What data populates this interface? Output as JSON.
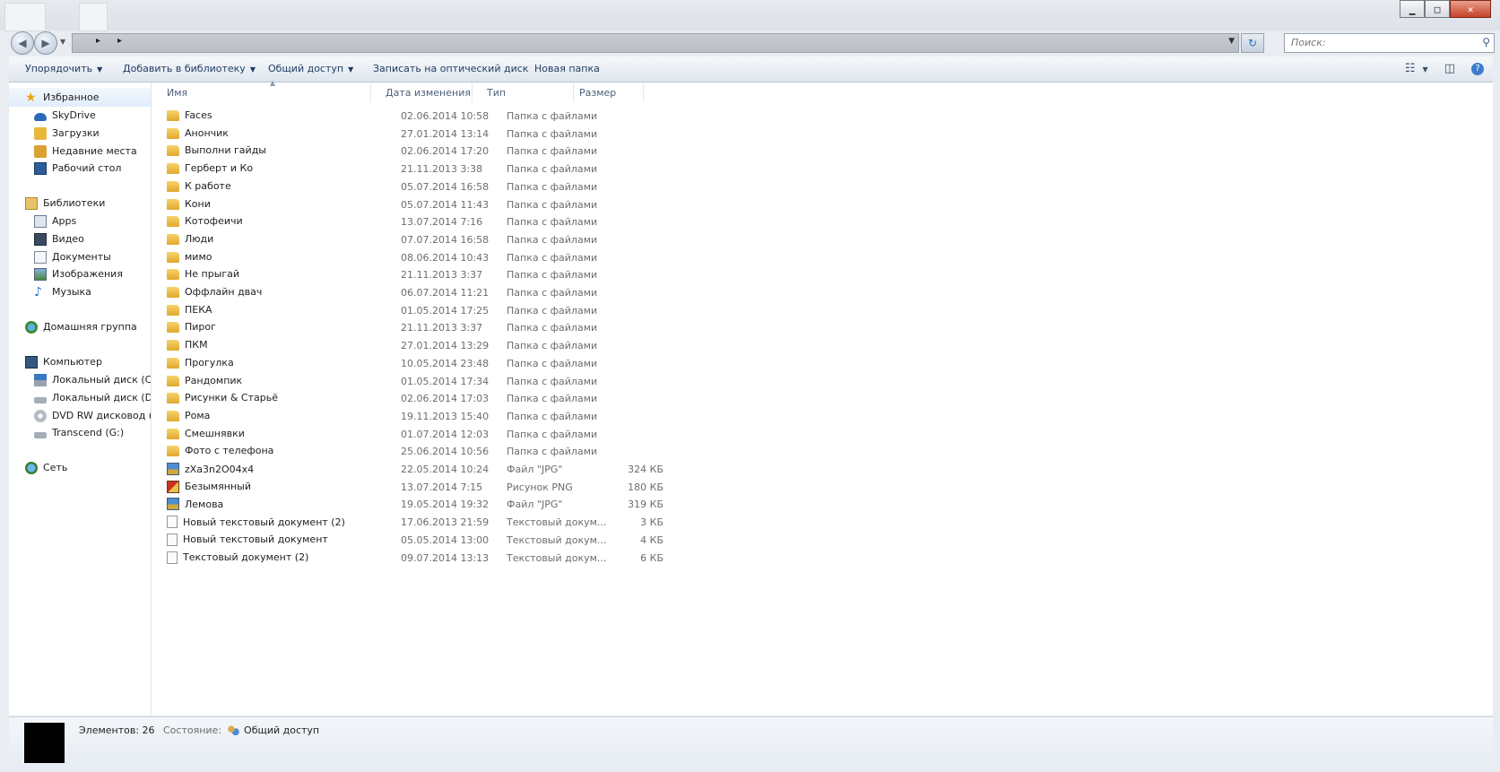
{
  "window_controls": {
    "minimize": "▁",
    "maximize": "□",
    "close": "✕"
  },
  "address_bar": {
    "crumb_separators": [
      "▸",
      "▸"
    ]
  },
  "search": {
    "placeholder": "Поиск:"
  },
  "toolbar": {
    "organize": "Упорядочить",
    "add_to_library": "Добавить в библиотеку",
    "share": "Общий доступ",
    "burn": "Записать на оптический диск",
    "new_folder": "Новая папка"
  },
  "navpane": {
    "favorites": "Избранное",
    "favorites_items": [
      "SkyDrive",
      "Загрузки",
      "Недавние места",
      "Рабочий стол"
    ],
    "libraries": "Библиотеки",
    "libraries_items": [
      "Apps",
      "Видео",
      "Документы",
      "Изображения",
      "Музыка"
    ],
    "homegroup": "Домашняя группа",
    "computer": "Компьютер",
    "computer_items": [
      "Локальный диск (C",
      "Локальный диск (D",
      "DVD RW дисковод (",
      "Transcend (G:)"
    ],
    "network": "Сеть"
  },
  "columns": {
    "name": "Имя",
    "date": "Дата изменения",
    "type": "Тип",
    "size": "Размер"
  },
  "files": [
    {
      "name": "Faces",
      "date": "02.06.2014 10:58",
      "type": "Папка с файлами",
      "size": "",
      "icon": "folder"
    },
    {
      "name": "Анончик",
      "date": "27.01.2014 13:14",
      "type": "Папка с файлами",
      "size": "",
      "icon": "folder"
    },
    {
      "name": "Выполни гайды",
      "date": "02.06.2014 17:20",
      "type": "Папка с файлами",
      "size": "",
      "icon": "folder"
    },
    {
      "name": "Герберт и Ко",
      "date": "21.11.2013 3:38",
      "type": "Папка с файлами",
      "size": "",
      "icon": "folder"
    },
    {
      "name": "К работе",
      "date": "05.07.2014 16:58",
      "type": "Папка с файлами",
      "size": "",
      "icon": "folder"
    },
    {
      "name": "Кони",
      "date": "05.07.2014 11:43",
      "type": "Папка с файлами",
      "size": "",
      "icon": "folder"
    },
    {
      "name": "Котофеичи",
      "date": "13.07.2014 7:16",
      "type": "Папка с файлами",
      "size": "",
      "icon": "folder"
    },
    {
      "name": "Люди",
      "date": "07.07.2014 16:58",
      "type": "Папка с файлами",
      "size": "",
      "icon": "folder"
    },
    {
      "name": "мимо",
      "date": "08.06.2014 10:43",
      "type": "Папка с файлами",
      "size": "",
      "icon": "folder"
    },
    {
      "name": "Не прыгай",
      "date": "21.11.2013 3:37",
      "type": "Папка с файлами",
      "size": "",
      "icon": "folder"
    },
    {
      "name": "Оффлайн двач",
      "date": "06.07.2014 11:21",
      "type": "Папка с файлами",
      "size": "",
      "icon": "folder"
    },
    {
      "name": "ПЕКА",
      "date": "01.05.2014 17:25",
      "type": "Папка с файлами",
      "size": "",
      "icon": "folder"
    },
    {
      "name": "Пирог",
      "date": "21.11.2013 3:37",
      "type": "Папка с файлами",
      "size": "",
      "icon": "folder"
    },
    {
      "name": "ПКМ",
      "date": "27.01.2014 13:29",
      "type": "Папка с файлами",
      "size": "",
      "icon": "folder"
    },
    {
      "name": "Прогулка",
      "date": "10.05.2014 23:48",
      "type": "Папка с файлами",
      "size": "",
      "icon": "folder"
    },
    {
      "name": "Рандомпик",
      "date": "01.05.2014 17:34",
      "type": "Папка с файлами",
      "size": "",
      "icon": "folder"
    },
    {
      "name": "Рисунки & Старьё",
      "date": "02.06.2014 17:03",
      "type": "Папка с файлами",
      "size": "",
      "icon": "folder"
    },
    {
      "name": "Рома",
      "date": "19.11.2013 15:40",
      "type": "Папка с файлами",
      "size": "",
      "icon": "folder"
    },
    {
      "name": "Смешнявки",
      "date": "01.07.2014 12:03",
      "type": "Папка с файлами",
      "size": "",
      "icon": "folder"
    },
    {
      "name": "Фото с телефона",
      "date": "25.06.2014 10:56",
      "type": "Папка с файлами",
      "size": "",
      "icon": "folder"
    },
    {
      "name": "zXa3n2O04x4",
      "date": "22.05.2014 10:24",
      "type": "Файл \"JPG\"",
      "size": "324 КБ",
      "icon": "jpg"
    },
    {
      "name": "Безымянный",
      "date": "13.07.2014 7:15",
      "type": "Рисунок PNG",
      "size": "180 КБ",
      "icon": "png"
    },
    {
      "name": "Лемова",
      "date": "19.05.2014 19:32",
      "type": "Файл \"JPG\"",
      "size": "319 КБ",
      "icon": "jpg"
    },
    {
      "name": "Новый текстовый документ (2)",
      "date": "17.06.2013 21:59",
      "type": "Текстовый докум...",
      "size": "3 КБ",
      "icon": "txt"
    },
    {
      "name": "Новый текстовый документ",
      "date": "05.05.2014 13:00",
      "type": "Текстовый докум...",
      "size": "4 КБ",
      "icon": "txt"
    },
    {
      "name": "Текстовый документ (2)",
      "date": "09.07.2014 13:13",
      "type": "Текстовый докум...",
      "size": "6 КБ",
      "icon": "txt"
    }
  ],
  "status": {
    "count_label": "Элементов: 26",
    "state_label": "Состояние:",
    "state_value": "Общий доступ"
  },
  "colors": {
    "folder": "#e8b83d",
    "selection": "#e1eefb",
    "toolbar_text": "#1e3a5f"
  }
}
